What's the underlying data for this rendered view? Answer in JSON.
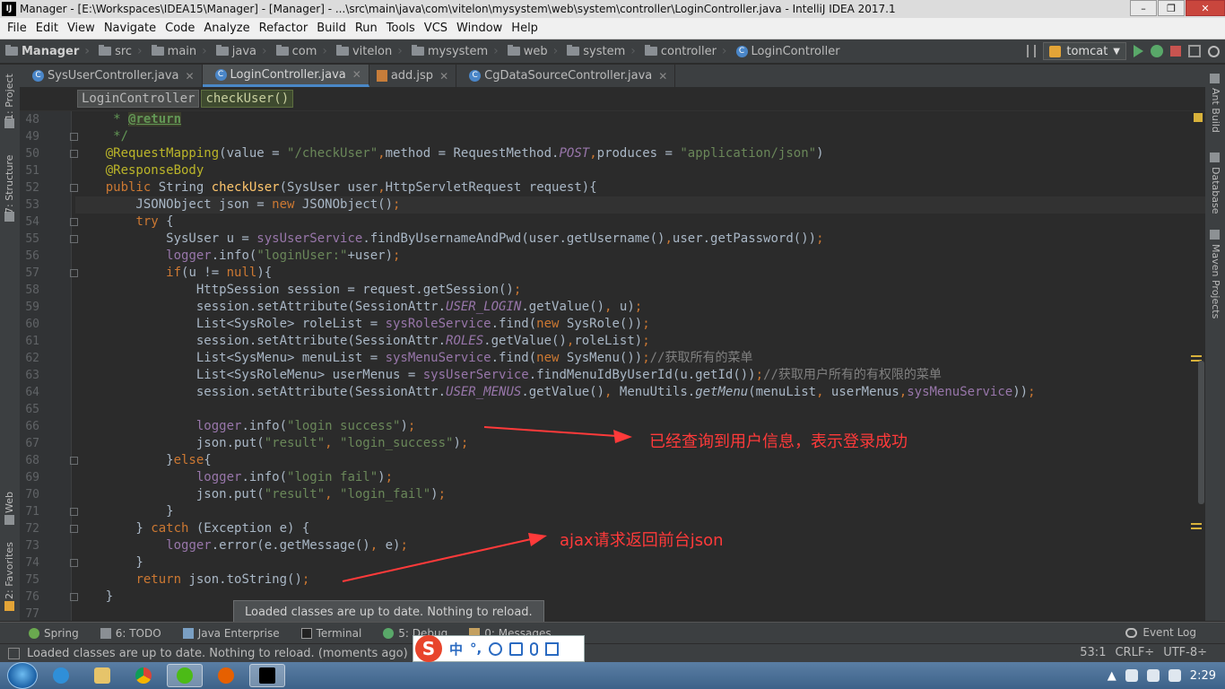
{
  "window": {
    "title": "Manager - [E:\\Workspaces\\IDEA15\\Manager] - [Manager] - ...\\src\\main\\java\\com\\vitelon\\mysystem\\web\\system\\controller\\LoginController.java - IntelliJ IDEA 2017.1",
    "logo": "IJ"
  },
  "menu": [
    "File",
    "Edit",
    "View",
    "Navigate",
    "Code",
    "Analyze",
    "Refactor",
    "Build",
    "Run",
    "Tools",
    "VCS",
    "Window",
    "Help"
  ],
  "breadcrumb": [
    "Manager",
    "src",
    "main",
    "java",
    "com",
    "vitelon",
    "mysystem",
    "web",
    "system",
    "controller",
    "LoginController"
  ],
  "run_config": "tomcat",
  "tabs": [
    {
      "label": "SysUserController.java",
      "active": false
    },
    {
      "label": "LoginController.java",
      "active": true
    },
    {
      "label": "add.jsp",
      "active": false
    },
    {
      "label": "CgDataSourceController.java",
      "active": false
    }
  ],
  "structure": {
    "class": "LoginController",
    "method": "checkUser()"
  },
  "left_tools": [
    "1: Project",
    "7: Structure",
    "Web",
    "2: Favorites"
  ],
  "right_tools": [
    "Ant Build",
    "Database",
    "Maven Projects"
  ],
  "line_numbers": [
    "48",
    "49",
    "50",
    "51",
    "52",
    "53",
    "54",
    "55",
    "56",
    "57",
    "58",
    "59",
    "60",
    "61",
    "62",
    "63",
    "64",
    "65",
    "66",
    "67",
    "68",
    "69",
    "70",
    "71",
    "72",
    "73",
    "74",
    "75",
    "76",
    "77"
  ],
  "annotations": {
    "success": "已经查询到用户信息，表示登录成功",
    "ajax": "ajax请求返回前台json"
  },
  "tooltip": "Loaded classes are up to date. Nothing to reload.",
  "tool_windows": [
    {
      "label": "Spring",
      "icon": "spring-icon"
    },
    {
      "label": "6: TODO",
      "icon": "todo-icon"
    },
    {
      "label": "Java Enterprise",
      "icon": "java-enterprise-icon"
    },
    {
      "label": "Terminal",
      "icon": "terminal-icon"
    },
    {
      "label": "5: Debug",
      "icon": "debug-icon"
    },
    {
      "label": "0: Messages",
      "icon": "messages-icon"
    }
  ],
  "event_log": "Event Log",
  "status": {
    "message": "Loaded classes are up to date. Nothing to reload. (moments ago)",
    "position": "53:1",
    "line_sep": "CRLF÷",
    "encoding": "UTF-8÷"
  },
  "ime": {
    "lang": "中",
    "punct": "°,"
  },
  "taskbar": {
    "clock": "2:29"
  },
  "colors": {
    "accent": "#4a88c7",
    "annotation": "#ff3a3a",
    "run": "#59a869",
    "stop": "#c75450"
  }
}
